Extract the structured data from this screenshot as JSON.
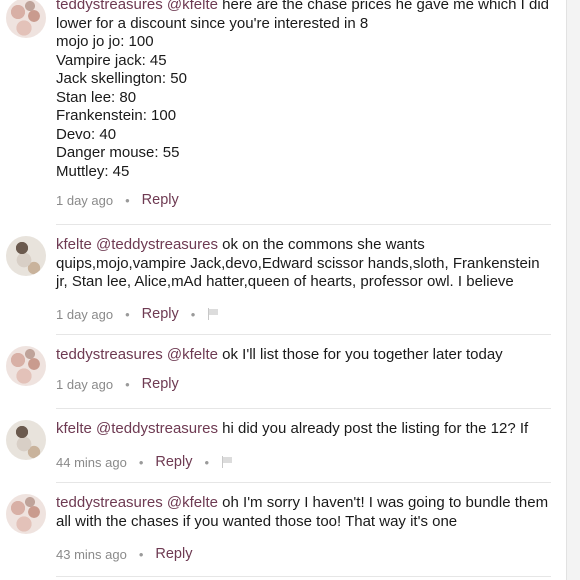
{
  "comments": [
    {
      "user": "teddystreasures",
      "mention": "@kfelte",
      "text": "here are the chase prices he gave me which I did lower for a discount since you're interested in 8",
      "lines": [
        "mojo jo jo: 100",
        "Vampire jack: 45",
        "Jack skellington: 50",
        "Stan lee: 80",
        "Frankenstein: 100",
        "Devo: 40",
        "Danger mouse: 55",
        "Muttley: 45"
      ],
      "time": "1 day ago",
      "reply": "Reply"
    },
    {
      "user": "kfelte",
      "mention": "@teddystreasures",
      "text": "ok on the commons she wants quips,mojo,vampire Jack,devo,Edward scissor hands,sloth, Frankenstein jr, Stan lee, Alice,mAd hatter,queen of hearts, professor owl. I believe",
      "time": "1 day ago",
      "reply": "Reply"
    },
    {
      "user": "teddystreasures",
      "mention": "@kfelte",
      "text": "ok I'll list those for you together later today",
      "time": "1 day ago",
      "reply": "Reply"
    },
    {
      "user": "kfelte",
      "mention": "@teddystreasures",
      "text": "hi did you already post the listing for the 12? If",
      "time": "44 mins ago",
      "reply": "Reply"
    },
    {
      "user": "teddystreasures",
      "mention": "@kfelte",
      "text": "oh I'm sorry I haven't! I was going to bundle them all with the chases if you wanted those too! That way it's one",
      "time": "43 mins ago",
      "reply": "Reply"
    }
  ],
  "icons": {
    "flag": "flag-icon",
    "dot": "•"
  },
  "colors": {
    "username": "#6e3a52",
    "meta": "#8a8a8a",
    "separator": "#e6e6e6"
  }
}
